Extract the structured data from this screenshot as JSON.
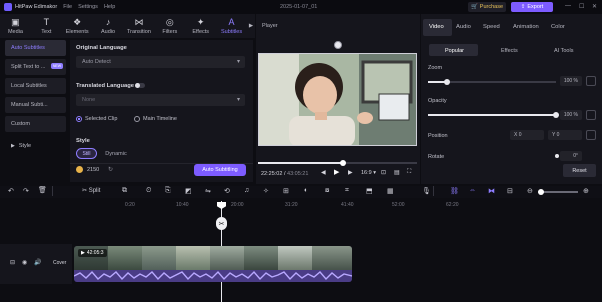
{
  "titlebar": {
    "app_name": "HitPaw Edimakor",
    "menus": [
      "File",
      "Settings",
      "Help"
    ],
    "date": "2025-01-07_01",
    "purchase": "Purchase",
    "export": "Export"
  },
  "tools": [
    {
      "label": "Media",
      "icon": "media-icon",
      "glyph": "▣"
    },
    {
      "label": "Text",
      "icon": "text-icon",
      "glyph": "T"
    },
    {
      "label": "Elements",
      "icon": "elements-icon",
      "glyph": "❖"
    },
    {
      "label": "Audio",
      "icon": "audio-icon",
      "glyph": "♪"
    },
    {
      "label": "Transition",
      "icon": "transition-icon",
      "glyph": "⋈"
    },
    {
      "label": "Filters",
      "icon": "filters-icon",
      "glyph": "◎"
    },
    {
      "label": "Effects",
      "icon": "effects-icon",
      "glyph": "✦"
    },
    {
      "label": "Subtitles",
      "icon": "subtitles-icon",
      "glyph": "A"
    }
  ],
  "sidenav": {
    "items": [
      {
        "label": "Auto Subtitles",
        "active": true,
        "badge": ""
      },
      {
        "label": "Split Text to ...",
        "active": false,
        "badge": "NEW"
      },
      {
        "label": "Local Subtitles",
        "active": false,
        "badge": ""
      },
      {
        "label": "Manual Subti...",
        "active": false,
        "badge": ""
      },
      {
        "label": "Custom",
        "active": false,
        "badge": ""
      }
    ],
    "style_label": "Style"
  },
  "panel": {
    "original_language_label": "Original Language",
    "original_language_value": "Auto Detect",
    "translated_language_label": "Translated Language",
    "translated_language_value": "None",
    "scope_options": [
      "Selected Clip",
      "Main Timeline"
    ],
    "style_label": "Style",
    "style_tabs": [
      "Still",
      "Dynamic"
    ],
    "credits": "2150",
    "auto_button": "Auto Subtitling"
  },
  "player": {
    "title": "Player",
    "time_current": "22:25:02",
    "time_total": "43:05:21",
    "ratio": "16:9"
  },
  "props": {
    "tabs": [
      "Video",
      "Audio",
      "Speed",
      "Animation",
      "Color"
    ],
    "subtabs": [
      "Popular",
      "Effects",
      "AI Tools"
    ],
    "zoom_label": "Zoom",
    "zoom_value": "100 %",
    "zoom_level": 0.15,
    "opacity_label": "Opacity",
    "opacity_value": "100 %",
    "opacity_level": 1.0,
    "position_label": "Position",
    "pos_x": "X  0",
    "pos_y": "Y  0",
    "rotate_label": "Rotate",
    "rotate_value": "0°",
    "reset": "Reset"
  },
  "timeline": {
    "split_label": "Split",
    "ruler": [
      "0:20",
      "10:40",
      "20:00",
      "31:20",
      "41:40",
      "52:00",
      "62:20"
    ],
    "track_label": "Cover",
    "clip_time": "42:05:3"
  }
}
